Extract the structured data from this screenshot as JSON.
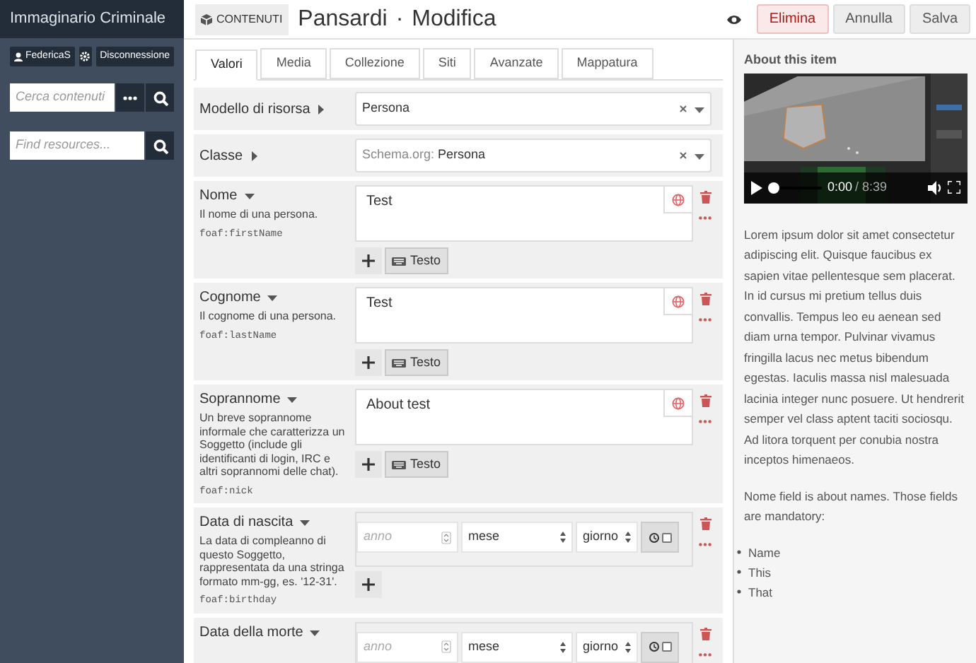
{
  "sidebar": {
    "title": "Immaginario Criminale",
    "user": "FedericaS",
    "logout": "Disconnessione",
    "search": {
      "placeholder": "Cerca contenuti"
    },
    "resource_search": {
      "placeholder": "Find resources..."
    }
  },
  "header": {
    "section_button": "CONTENUTI",
    "title": "Pansardi",
    "separator": "·",
    "subtitle": "Modifica",
    "buttons": [
      {
        "label": "Elimina",
        "kind": "danger"
      },
      {
        "label": "Annulla",
        "kind": "plain"
      },
      {
        "label": "Salva",
        "kind": "plain"
      }
    ]
  },
  "tabs": [
    {
      "label": "Valori",
      "selected": true
    },
    {
      "label": "Media",
      "selected": false
    },
    {
      "label": "Collezione",
      "selected": false
    },
    {
      "label": "Siti",
      "selected": false
    },
    {
      "label": "Avanzate",
      "selected": false
    },
    {
      "label": "Mappatura",
      "selected": false
    }
  ],
  "fields": [
    {
      "kind": "select",
      "label": "Modello di risorsa",
      "value": "Persona"
    },
    {
      "kind": "select",
      "label": "Classe",
      "prefix": "Schema.org:",
      "value": "Persona"
    },
    {
      "kind": "text",
      "label": "Nome",
      "description": "Il nome di una persona.",
      "term": "foaf:firstName",
      "value": "Test",
      "type_button": "Testo"
    },
    {
      "kind": "text",
      "label": "Cognome",
      "description": "Il cognome di una persona.",
      "term": "foaf:lastName",
      "value": "Test",
      "type_button": "Testo"
    },
    {
      "kind": "text",
      "label": "Soprannome",
      "description": "Un breve soprannome informale che caratterizza un Soggetto (include gli identificanti di login, IRC e altri soprannomi delle chat).",
      "term": "foaf:nick",
      "value": "About test",
      "type_button": "Testo"
    },
    {
      "kind": "date",
      "label": "Data di nascita",
      "description": "La data di compleanno di questo Soggetto, rappresentata da una stringa formato mm-gg, es. '12-31'.",
      "term": "foaf:birthday",
      "add_button": true,
      "year": "anno",
      "month": "mese",
      "day": "giorno"
    },
    {
      "kind": "date",
      "label": "Data della morte",
      "year": "anno",
      "month": "mese",
      "day": "giorno"
    }
  ],
  "about": {
    "title": "About this item",
    "video": {
      "kind": "picture",
      "level": 0,
      "time": "0:00",
      "duration": "/ 8:39"
    },
    "paragraphs": [
      "Lorem ipsum dolor sit amet consectetur adipiscing elit. Quisque faucibus ex sapien vitae pellentesque sem placerat. In id cursus mi pretium tellus duis convallis. Tempus leo eu aenean sed diam urna tempor. Pulvinar vivamus fringilla lacus nec metus bibendum egestas. Iaculis massa nisl malesuada lacinia integer nunc posuere. Ut hendrerit semper vel class aptent taciti sociosqu. Ad litora torquent per conubia nostra inceptos himenaeos.",
      "Nome field is about names. Those fields are mandatory:"
    ],
    "list": [
      "Name",
      "This",
      "That"
    ]
  }
}
